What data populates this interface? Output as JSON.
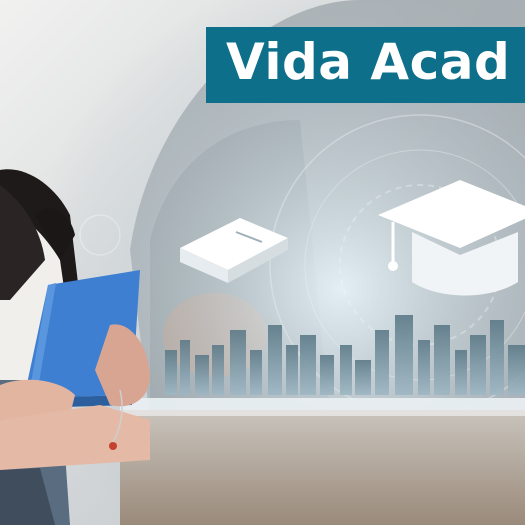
{
  "banner": {
    "title": "Vida Acad"
  },
  "icons": [
    "book-icon",
    "graduation-cap-icon"
  ],
  "colors": {
    "banner_bg": "#0d6f8a",
    "banner_text": "#ffffff",
    "book_blue": "#3f7fd1"
  }
}
